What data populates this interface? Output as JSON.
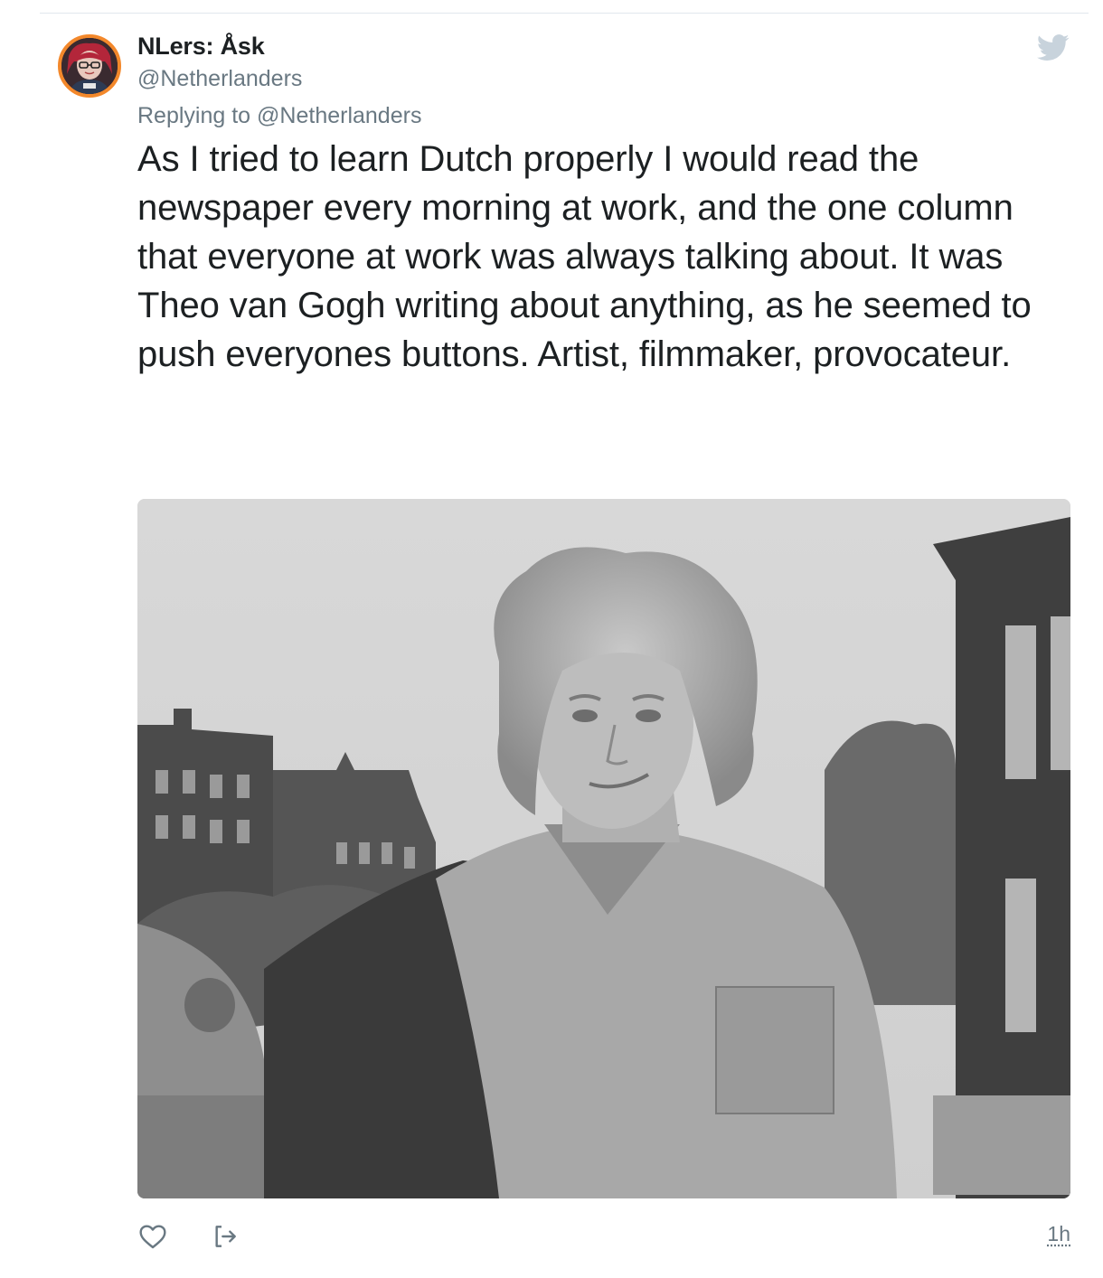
{
  "author": {
    "display_name": "NLers: Åsk",
    "handle": "@Netherlanders"
  },
  "reply_context": {
    "prefix": "Replying to ",
    "handle": "@Netherlanders"
  },
  "tweet": {
    "text": "As I tried to learn Dutch properly I would read the newspaper every morning at work, and the one column that everyone at work was always talking about. It was Theo van Gogh writing about anything, as he seemed to push everyones buttons. Artist, filmmaker, provocateur.",
    "timestamp": "1h"
  },
  "icons": {
    "brand": "twitter-bird-icon",
    "like": "heart-icon",
    "share": "share-icon"
  },
  "colors": {
    "avatar_ring": "#f3882b",
    "secondary_text": "#697882",
    "primary_text": "#1c2022",
    "divider": "#e1e8ed",
    "brand_logo": "#c8d3dc"
  }
}
